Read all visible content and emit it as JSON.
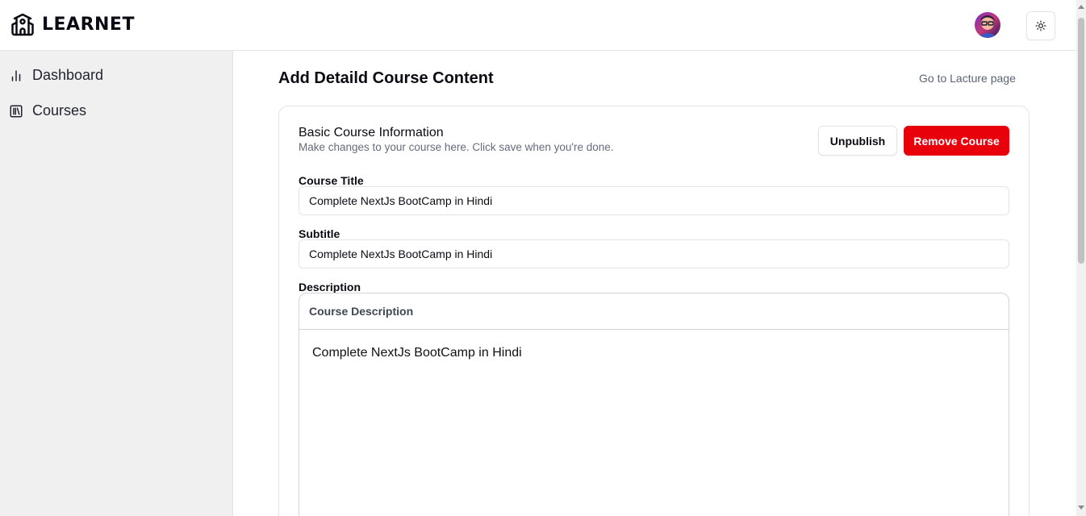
{
  "header": {
    "brand": "LEARNET",
    "brand_icon": "school-icon",
    "avatar_icon": "user-avatar",
    "theme_icon": "sun-icon"
  },
  "sidebar": {
    "items": [
      {
        "label": "Dashboard",
        "icon": "bar-chart-icon"
      },
      {
        "label": "Courses",
        "icon": "library-icon"
      }
    ]
  },
  "main": {
    "title": "Add Detaild Course Content",
    "lecture_link": "Go to Lacture page"
  },
  "card": {
    "title": "Basic Course Information",
    "description": "Make changes to your course here. Click save when you're done.",
    "unpublish_label": "Unpublish",
    "remove_label": "Remove Course",
    "danger_color": "#e8000b"
  },
  "form": {
    "course_title_label": "Course Title",
    "course_title_value": "Complete NextJs BootCamp in Hindi",
    "subtitle_label": "Subtitle",
    "subtitle_value": "Complete NextJs BootCamp in Hindi",
    "description_label": "Description",
    "editor_toolbar_label": "Course Description",
    "editor_content": "Complete NextJs BootCamp in Hindi"
  }
}
